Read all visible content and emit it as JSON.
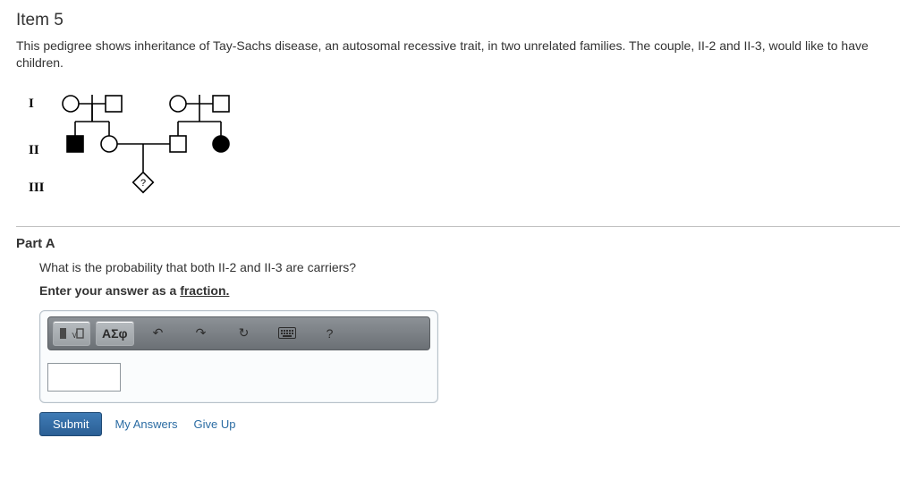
{
  "item_title": "Item 5",
  "prompt": "This pedigree shows inheritance of Tay-Sachs disease, an autosomal recessive trait, in two unrelated families. The couple, II-2 and II-3, would like to have children.",
  "generations": {
    "I": "I",
    "II": "II",
    "III": "III"
  },
  "part_label": "Part A",
  "question": "What is the probability that both II-2 and II-3 are carriers?",
  "instruction_lead": "Enter your answer as a ",
  "instruction_underlined": "fraction.",
  "toolbar": {
    "templates": "▢√▢",
    "greek": "ΑΣφ",
    "undo": "↶",
    "redo": "↷",
    "reset": "↻",
    "keyboard": "⌨",
    "help": "?"
  },
  "actions": {
    "submit": "Submit",
    "my_answers": "My Answers",
    "give_up": "Give Up"
  },
  "answer_value": ""
}
